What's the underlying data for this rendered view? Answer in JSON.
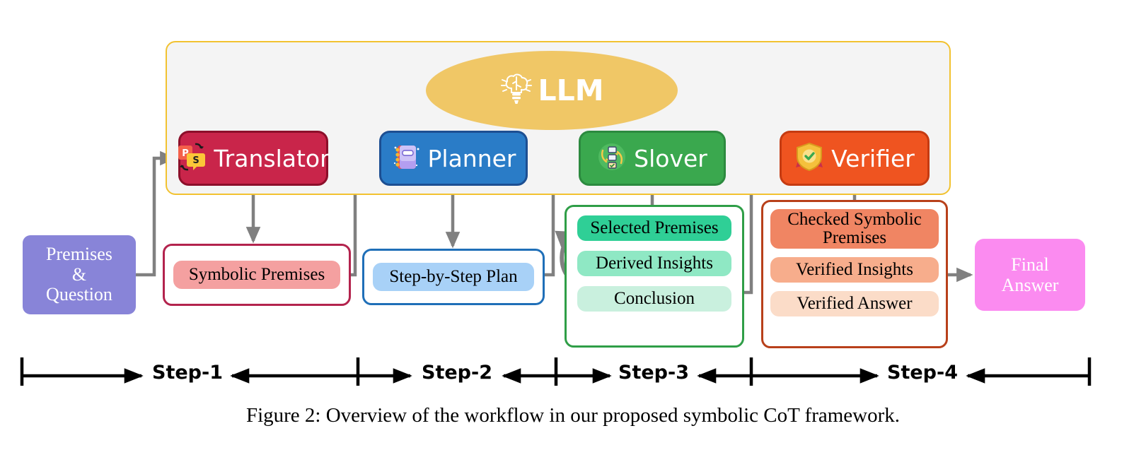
{
  "figure": {
    "caption": "Figure 2: Overview of the workflow in our proposed symbolic CoT framework."
  },
  "llm": {
    "label": "LLM",
    "icon": "brain-lightbulb-icon",
    "container_bg": "#f4f4f4",
    "container_border": "#f2c230",
    "ellipse_color": "#f0c766"
  },
  "agents": [
    {
      "id": "translator",
      "label": "Translator",
      "icon": "translate-icon",
      "bg": "#c9254a",
      "border": "#8c0f2a"
    },
    {
      "id": "planner",
      "label": "Planner",
      "icon": "notebook-icon",
      "bg": "#2a7cc7",
      "border": "#1d4f92"
    },
    {
      "id": "slover",
      "label": "Slover",
      "icon": "checklist-loop-icon",
      "bg": "#3aa84e",
      "border": "#2c8a3f"
    },
    {
      "id": "verifier",
      "label": "Verifier",
      "icon": "shield-check-icon",
      "bg": "#ef5420",
      "border": "#c53b11"
    }
  ],
  "input": {
    "label_line1": "Premises",
    "label_line2": "&",
    "label_line3": "Question",
    "color": "#8884d8"
  },
  "step1": {
    "border": "#b3234d",
    "items": [
      {
        "label": "Symbolic Premises",
        "color": "#f4a0a0"
      }
    ]
  },
  "step2": {
    "border": "#1f6fb8",
    "items": [
      {
        "label": "Step-by-Step Plan",
        "color": "#a8d1f7"
      }
    ]
  },
  "step3": {
    "border": "#2f9e47",
    "items": [
      {
        "label": "Selected Premises",
        "color": "#2fcf96"
      },
      {
        "label": "Derived Insights",
        "color": "#8fe8c4"
      },
      {
        "label": "Conclusion",
        "color": "#c9f0de"
      }
    ]
  },
  "step4": {
    "border": "#b8401a",
    "items": [
      {
        "label": "Checked Symbolic Premises",
        "color": "#f08563"
      },
      {
        "label": "Verified Insights",
        "color": "#f7ad8c"
      },
      {
        "label": "Verified Answer",
        "color": "#fbdcc8"
      }
    ]
  },
  "output": {
    "label_line1": "Final",
    "label_line2": "Answer",
    "color": "#fb8bf0"
  },
  "step_scale": {
    "labels": [
      "Step-1",
      "Step-2",
      "Step-3",
      "Step-4"
    ]
  },
  "colors": {
    "connector": "#808080",
    "llm_arrow": "#f5dfa0",
    "axis": "#000000"
  }
}
